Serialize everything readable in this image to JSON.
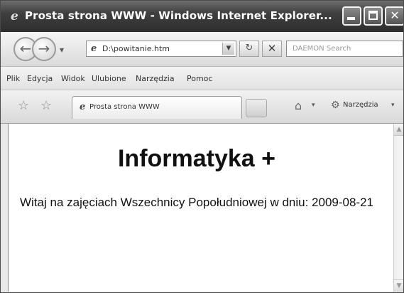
{
  "window": {
    "title": "Prosta strona WWW - Windows Internet Explorer...",
    "title_icon": "e-icon"
  },
  "address_bar": {
    "value": "D:\\powitanie.htm",
    "search_placeholder": "DAEMON Search"
  },
  "menu": {
    "items": [
      "Plik",
      "Edycja",
      "Widok",
      "Ulubione",
      "Narzędzia",
      "Pomoc"
    ]
  },
  "tabs": {
    "active_label": "Prosta strona WWW"
  },
  "command_bar": {
    "tools_label": "Narzędzia"
  },
  "page": {
    "heading": "Informatyka +",
    "paragraph": "Witaj na zajęciach Wszechnicy Popołudniowej w dniu: 2009-08-21"
  }
}
